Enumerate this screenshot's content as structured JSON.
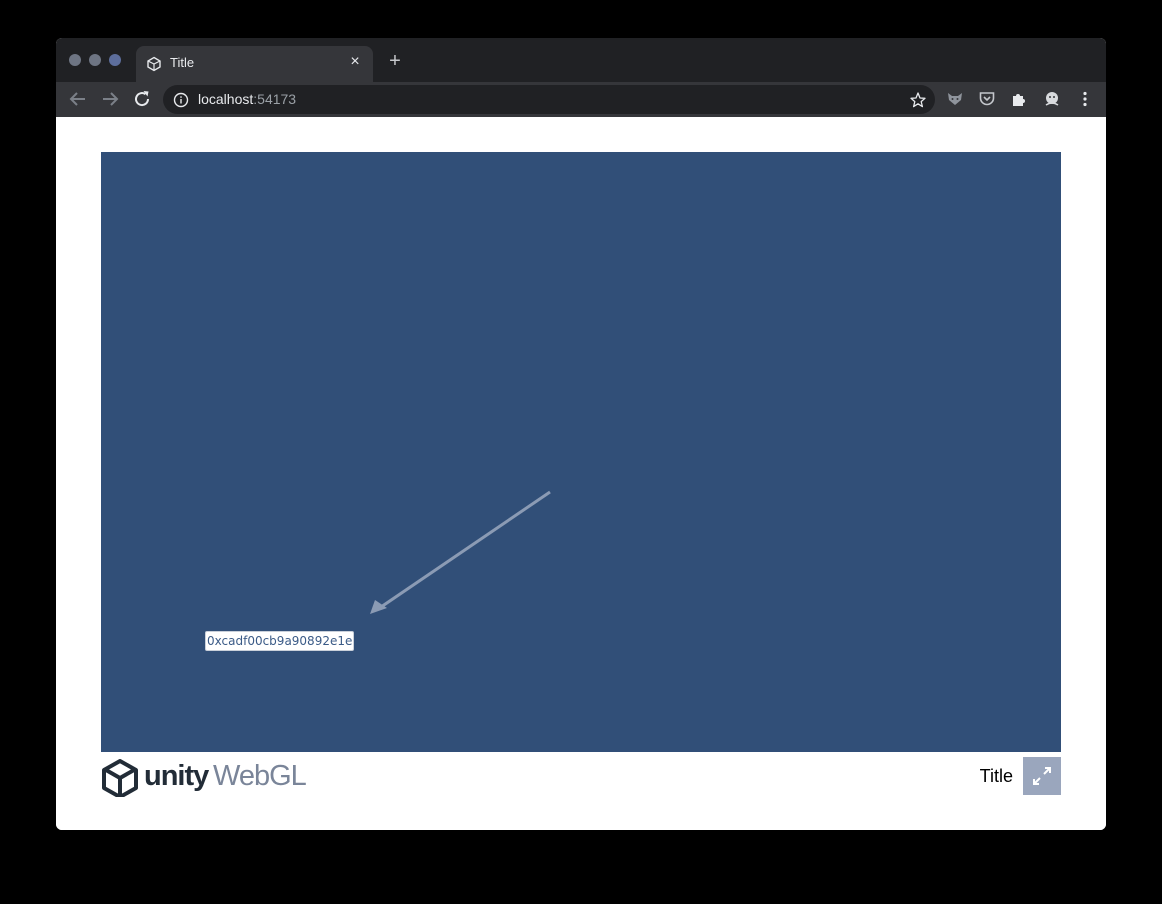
{
  "browser": {
    "tab_title": "Title",
    "tab_close": "×",
    "new_tab": "+",
    "url_host": "localhost",
    "url_port": ":54173"
  },
  "game": {
    "address_label": "0xcadf00cb9a90892e1e"
  },
  "footer": {
    "unity": "unity",
    "webgl": "WebGL",
    "title": "Title"
  },
  "colors": {
    "canvas_bg": "#314f78",
    "chrome_dark": "#202124",
    "chrome_toolbar": "#35363a",
    "fullscreen_btn": "#9aa6bd"
  },
  "icons": {
    "tab": "unity-tab-icon",
    "back": "arrow-left-icon",
    "forward": "arrow-right-icon",
    "reload": "reload-icon",
    "info": "info-icon",
    "star": "star-icon",
    "ext1": "fox-extension-icon",
    "ext2": "pocket-icon",
    "ext3": "puzzle-icon",
    "ext4": "avatar-extension-icon",
    "menu": "kebab-menu-icon",
    "fullscreen": "fullscreen-icon"
  }
}
